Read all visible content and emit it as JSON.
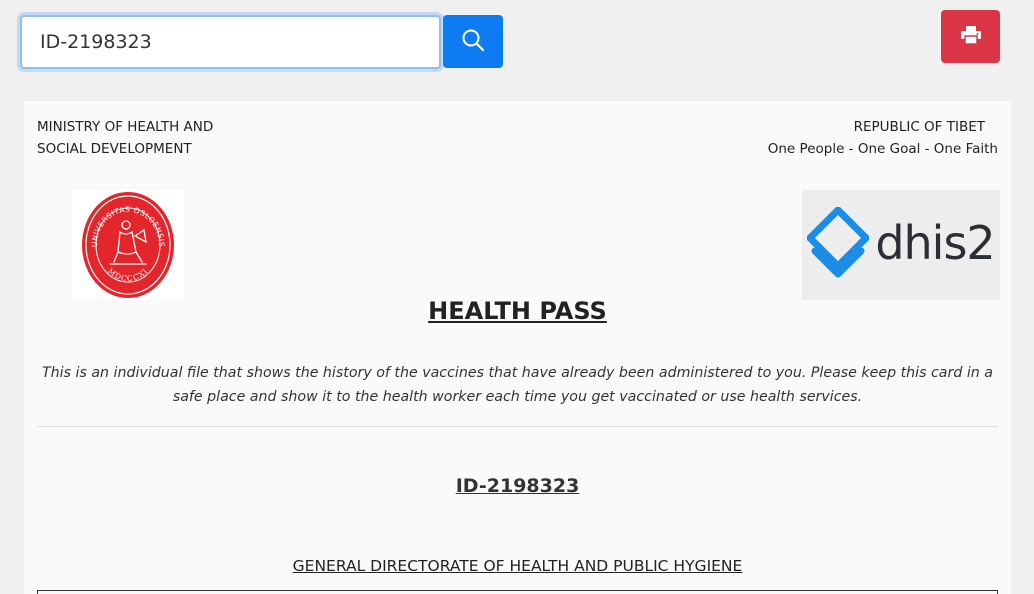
{
  "search": {
    "value": "ID-2198323"
  },
  "icons": {
    "search_button": "search-icon",
    "print_button": "printer-icon",
    "seal": "university-seal-icon",
    "dhis": "dhis2-logo-icon"
  },
  "colors": {
    "search_button": "#0d7cf2",
    "print_button": "#dc3545",
    "seal_red": "#e3262b"
  },
  "card": {
    "ministry_line1": "MINISTRY OF HEALTH AND",
    "ministry_line2": "SOCIAL DEVELOPMENT",
    "republic": "REPUBLIC OF TIBET",
    "motto": "One People - One Goal - One Faith",
    "seal_text_top": "UNIVERSITAS OSLOENSIS",
    "seal_text_bottom": "MDCCCXI",
    "logo_text": "dhis2",
    "title": "HEALTH PASS",
    "description": "This is an individual file that shows the history of the vaccines that have already been administered to you. Please keep this card in a safe place and show it to the health worker each time you get vaccinated or use health services.",
    "record_id": "ID-2198323",
    "directorate": "GENERAL DIRECTORATE OF HEALTH AND PUBLIC HYGIENE"
  }
}
